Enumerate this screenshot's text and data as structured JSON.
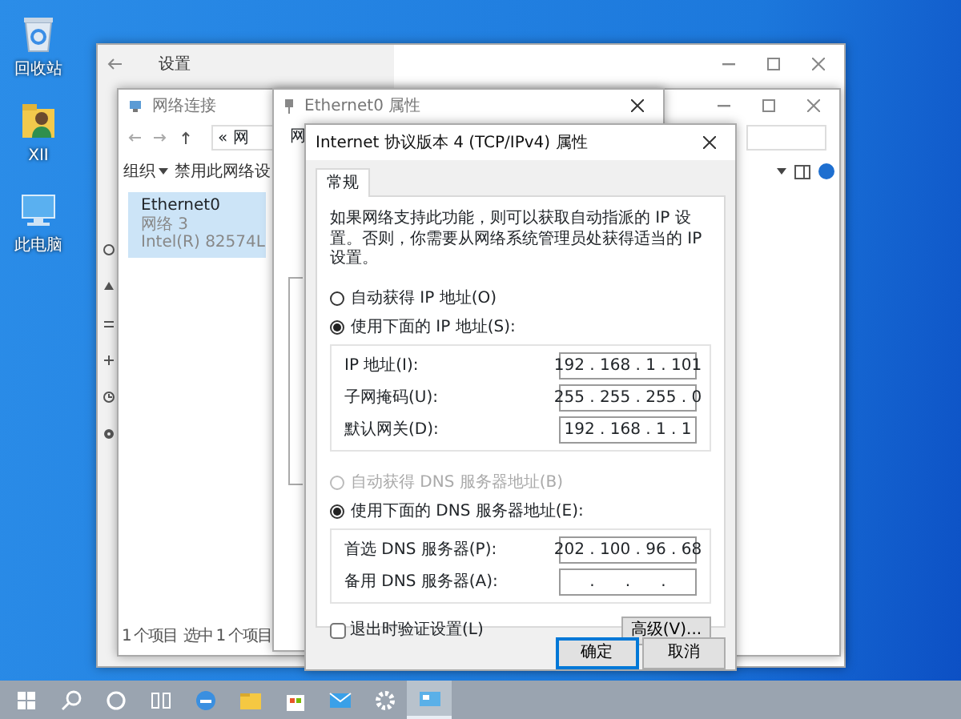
{
  "desktop_icons": [
    {
      "kind": "recycle",
      "label": "回收站"
    },
    {
      "kind": "user",
      "label": "XII"
    },
    {
      "kind": "pc",
      "label": "此电脑"
    }
  ],
  "settings_window": {
    "title": "设置"
  },
  "network_window": {
    "title": "网络连接",
    "address": "« 网",
    "commands": [
      {
        "label": "组织",
        "menu": true
      },
      {
        "label": "禁用此网络设",
        "menu": false
      }
    ],
    "adapter": {
      "name": "Ethernet0",
      "network": "网络 3",
      "device": "Intel(R) 82574L",
      "selected": true
    },
    "status": [
      "1 个项目",
      "选中 1 个项目"
    ]
  },
  "ethernet_window": {
    "title": "Ethernet0 属性",
    "tab": "网"
  },
  "ipv4_dialog": {
    "title": "Internet 协议版本 4 (TCP/IPv4) 属性",
    "tabs": [
      {
        "label": "常规",
        "selected": true
      }
    ],
    "description": "如果网络支持此功能，则可以获取自动指派的 IP 设置。否则，你需要从网络系统管理员处获得适当的 IP 设置。",
    "ip_options": [
      {
        "label": "自动获得 IP 地址(O)",
        "selected": false,
        "disabled": false
      },
      {
        "label": "使用下面的 IP 地址(S):",
        "selected": true,
        "disabled": false
      }
    ],
    "ip_fields": [
      {
        "label": "IP 地址(I):",
        "value": "192 . 168 . 1 . 101"
      },
      {
        "label": "子网掩码(U):",
        "value": "255 . 255 . 255 . 0"
      },
      {
        "label": "默认网关(D):",
        "value": "192 . 168 . 1 . 1"
      }
    ],
    "dns_options": [
      {
        "label": "自动获得 DNS 服务器地址(B)",
        "selected": false,
        "disabled": true
      },
      {
        "label": "使用下面的 DNS 服务器地址(E):",
        "selected": true,
        "disabled": false
      }
    ],
    "dns_fields": [
      {
        "label": "首选 DNS 服务器(P):",
        "value": "202 . 100 . 96 . 68"
      },
      {
        "label": "备用 DNS 服务器(A):",
        "value": ".      .      ."
      }
    ],
    "validate": {
      "label": "退出时验证设置(L)",
      "checked": false
    },
    "advanced_button": "高级(V)...",
    "buttons": [
      {
        "label": "确定",
        "default": true
      },
      {
        "label": "取消",
        "default": false
      }
    ]
  },
  "taskbar": {
    "items": [
      {
        "kind": "start",
        "selected": false
      },
      {
        "kind": "search",
        "selected": false
      },
      {
        "kind": "cortana",
        "selected": false
      },
      {
        "kind": "taskview",
        "selected": false
      },
      {
        "kind": "edge",
        "selected": false
      },
      {
        "kind": "explorer",
        "selected": false
      },
      {
        "kind": "store",
        "selected": false
      },
      {
        "kind": "mail",
        "selected": false
      },
      {
        "kind": "settings",
        "selected": false
      },
      {
        "kind": "window",
        "selected": true
      }
    ]
  }
}
